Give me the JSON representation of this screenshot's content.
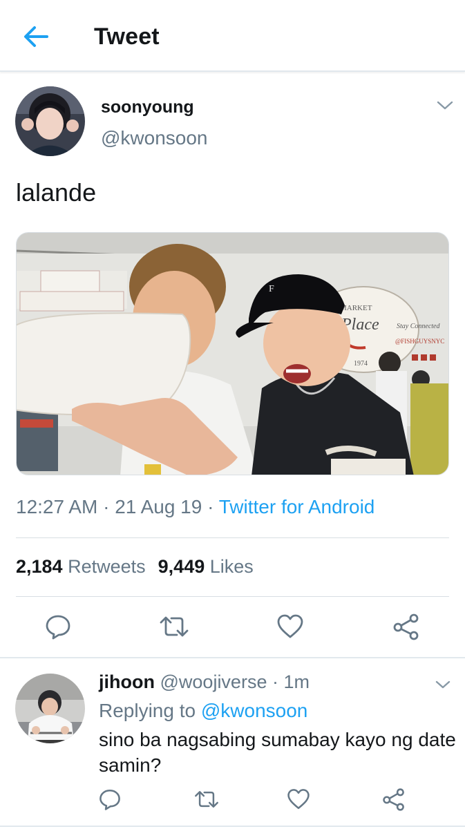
{
  "header": {
    "title": "Tweet",
    "back_icon": "arrow-left-icon",
    "accent": "#1da1f2"
  },
  "tweet": {
    "author_name": "soonyoung",
    "author_handle": "@kwonsoon",
    "text": "lalande",
    "time": "12:27 AM",
    "sep1": " · ",
    "date": "21 Aug 19",
    "sep2": " · ",
    "source": "Twitter for Android",
    "retweets_count": "2,184",
    "retweets_label": "Retweets",
    "likes_count": "9,449",
    "likes_label": "Likes",
    "media": {
      "sign_market": "MARKET",
      "sign_script": "Place",
      "sign_year": "1974",
      "sign_stay": "Stay Connected",
      "sign_handle": "@FISHGUYSNYC"
    }
  },
  "actions": [
    "reply-icon",
    "retweet-icon",
    "like-icon",
    "share-icon"
  ],
  "reply": {
    "author_name": "jihoon",
    "author_handle": "@woojiverse",
    "sep": " · ",
    "time": "1m",
    "replying_to_label": "Replying to",
    "replying_to_handle": "@kwonsoon",
    "text": "sino ba nagsabing sumabay kayo ng date samin?"
  }
}
